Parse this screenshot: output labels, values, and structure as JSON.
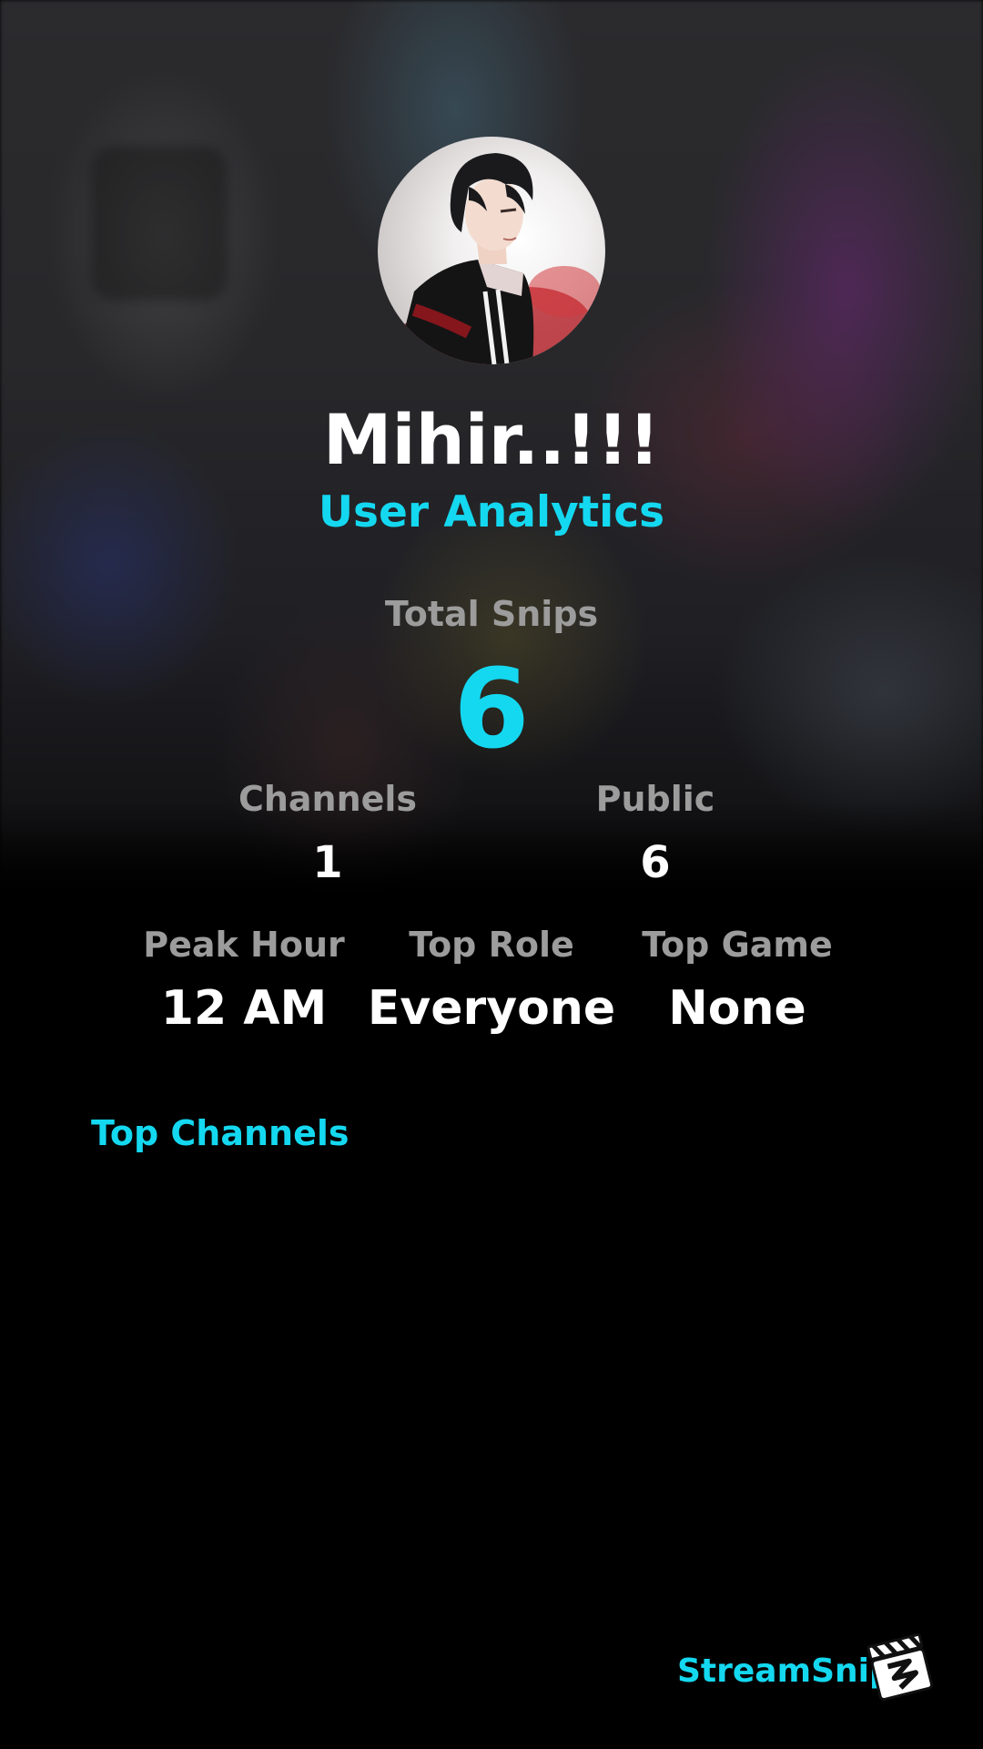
{
  "profile": {
    "username": "Mihir..!!!",
    "subtitle": "User Analytics"
  },
  "totals": {
    "label": "Total Snips",
    "value": "6"
  },
  "stats_row1": [
    {
      "label": "Channels",
      "value": "1"
    },
    {
      "label": "Public",
      "value": "6"
    }
  ],
  "stats_row2": [
    {
      "label": "Peak Hour",
      "value": "12 AM"
    },
    {
      "label": "Top Role",
      "value": "Everyone"
    },
    {
      "label": "Top Game",
      "value": "None"
    }
  ],
  "sections": {
    "top_channels_title": "Top Channels"
  },
  "branding": {
    "name": "StreamSnip",
    "icon": "clapperboard-logo-icon"
  },
  "colors": {
    "accent": "#14d8f0",
    "background": "#000000",
    "muted_label": "#9c9c9c",
    "value_text": "#ffffff"
  }
}
